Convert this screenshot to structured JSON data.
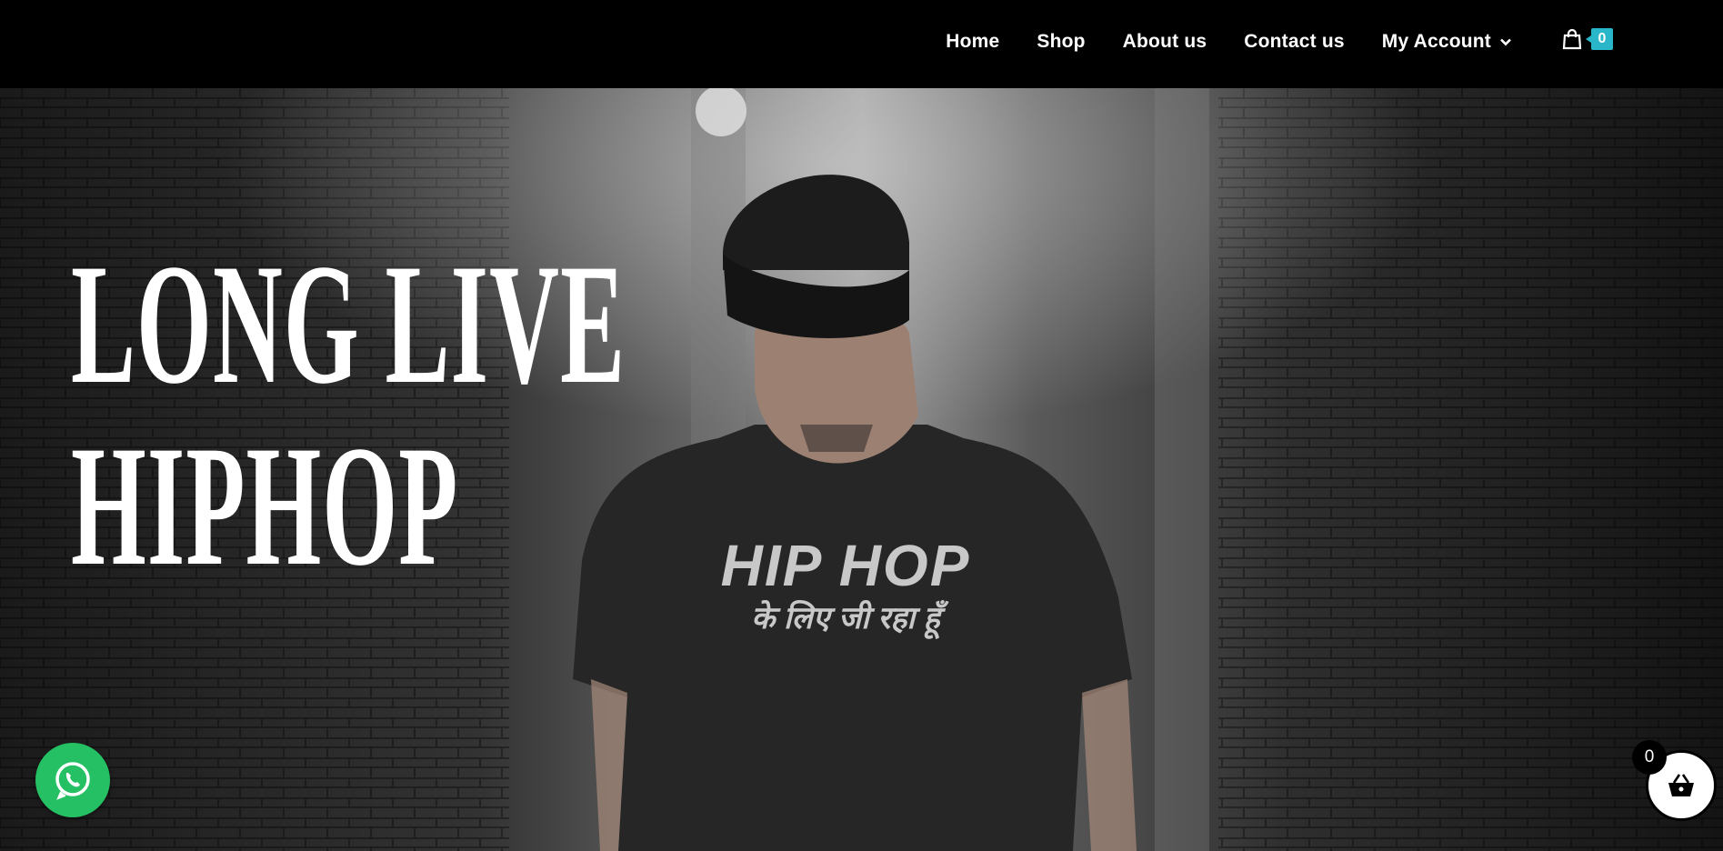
{
  "nav": {
    "items": [
      {
        "label": "Home"
      },
      {
        "label": "Shop"
      },
      {
        "label": "About us"
      },
      {
        "label": "Contact us"
      },
      {
        "label": "My Account"
      }
    ],
    "cart_count": "0"
  },
  "hero": {
    "headline_line1": "LONG LIVE",
    "headline_line2": "HIPHOP",
    "shirt_text_line1": "HIP HOP",
    "shirt_text_line2": "के लिए जी रहा हूँ"
  },
  "widgets": {
    "basket_count": "0"
  },
  "colors": {
    "header_bg": "#000000",
    "cart_badge": "#29b6c8",
    "whatsapp": "#25c063"
  },
  "icons": [
    "shopping-bag-icon",
    "chevron-down-icon",
    "whatsapp-icon",
    "basket-icon"
  ]
}
